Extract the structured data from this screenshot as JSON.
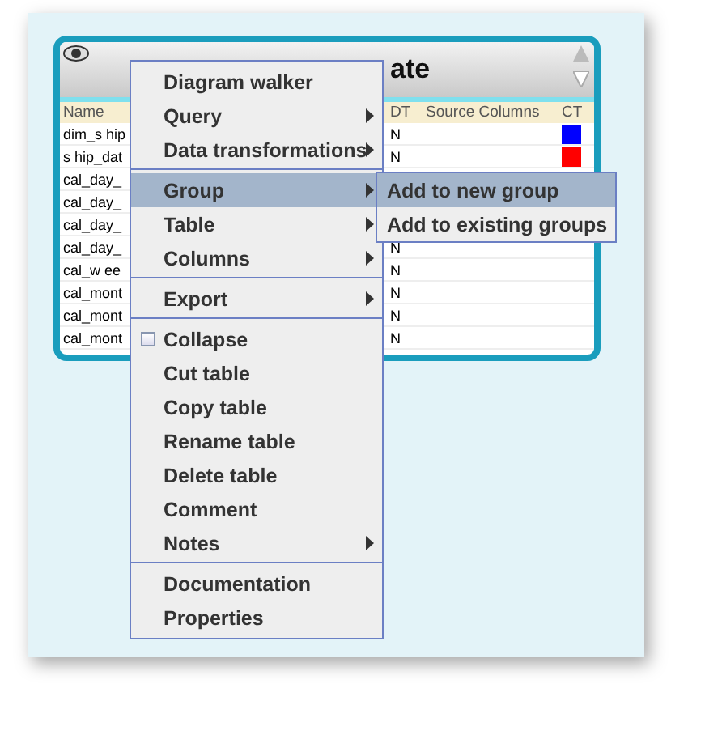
{
  "table_window": {
    "title": "ate",
    "columns": [
      {
        "label": "Name"
      },
      {
        "label": "DT"
      },
      {
        "label": "Source Columns"
      },
      {
        "label": "CT"
      }
    ],
    "rows": [
      {
        "name": "dim_s hip",
        "dt": "N",
        "color": "#0000ff"
      },
      {
        "name": "s hip_dat",
        "dt": "N",
        "color": "#ff0000"
      },
      {
        "name": "cal_day_"
      },
      {
        "name": "cal_day_"
      },
      {
        "name": "cal_day_"
      },
      {
        "name": "cal_day_",
        "dt": "N"
      },
      {
        "name": "cal_w ee",
        "dt": "N"
      },
      {
        "name": "cal_mont",
        "dt": "N"
      },
      {
        "name": "cal_mont",
        "dt": "N"
      },
      {
        "name": "cal_mont",
        "dt": "N"
      }
    ]
  },
  "context_menu": {
    "items": [
      {
        "kind": "item",
        "label": "Diagram walker",
        "submenu": false,
        "selected": false
      },
      {
        "kind": "item",
        "label": "Query",
        "submenu": true,
        "selected": false
      },
      {
        "kind": "item",
        "label": "Data transformations",
        "submenu": true,
        "selected": false
      },
      {
        "kind": "separator"
      },
      {
        "kind": "item",
        "label": "Group",
        "submenu": true,
        "selected": true
      },
      {
        "kind": "item",
        "label": "Table",
        "submenu": true,
        "selected": false
      },
      {
        "kind": "item",
        "label": "Columns",
        "submenu": true,
        "selected": false
      },
      {
        "kind": "separator"
      },
      {
        "kind": "item",
        "label": "Export",
        "submenu": true,
        "selected": false
      },
      {
        "kind": "separator"
      },
      {
        "kind": "checkbox",
        "label": "Collapse",
        "checked": false,
        "selected": false
      },
      {
        "kind": "item",
        "label": "Cut table",
        "submenu": false,
        "selected": false
      },
      {
        "kind": "item",
        "label": "Copy table",
        "submenu": false,
        "selected": false
      },
      {
        "kind": "item",
        "label": "Rename table",
        "submenu": false,
        "selected": false
      },
      {
        "kind": "item",
        "label": "Delete table",
        "submenu": false,
        "selected": false
      },
      {
        "kind": "item",
        "label": "Comment",
        "submenu": false,
        "selected": false
      },
      {
        "kind": "item",
        "label": "Notes",
        "submenu": true,
        "selected": false
      },
      {
        "kind": "separator"
      },
      {
        "kind": "item",
        "label": "Documentation",
        "submenu": false,
        "selected": false
      },
      {
        "kind": "item",
        "label": "Properties",
        "submenu": false,
        "selected": false
      }
    ]
  },
  "submenu": {
    "items": [
      {
        "label": "Add to new group",
        "selected": true
      },
      {
        "label": "Add to existing groups",
        "selected": false
      }
    ]
  }
}
